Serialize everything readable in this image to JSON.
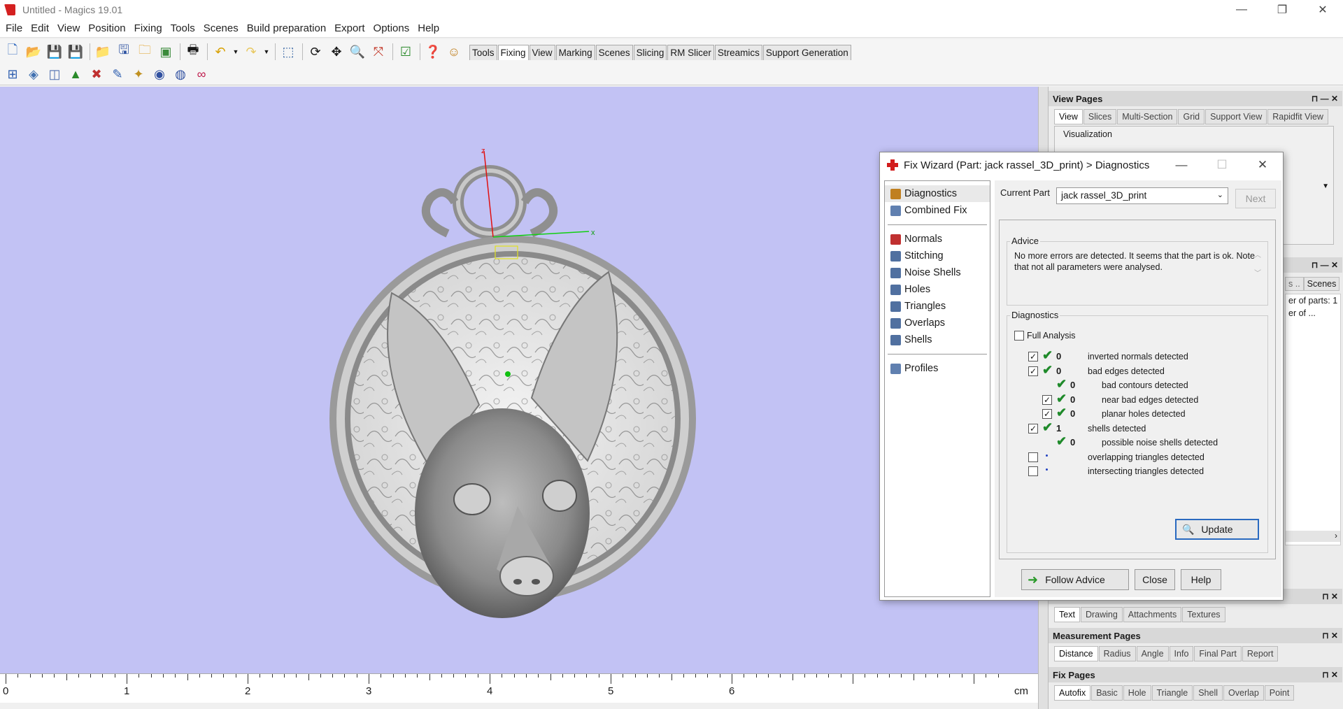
{
  "window": {
    "title": "Untitled - Magics 19.01",
    "min": "—",
    "max": "❐",
    "close": "✕"
  },
  "menu": [
    "File",
    "Edit",
    "View",
    "Position",
    "Fixing",
    "Tools",
    "Scenes",
    "Build preparation",
    "Export",
    "Options",
    "Help"
  ],
  "toolbar_tabs": [
    "Tools",
    "Fixing",
    "View",
    "Marking",
    "Scenes",
    "Slicing",
    "RM Slicer",
    "Streamics",
    "Support Generation"
  ],
  "active_toolbar_tab": "Fixing",
  "axes": {
    "z": "z",
    "x": "x"
  },
  "ruler": {
    "ticks": [
      "0",
      "1",
      "2",
      "3",
      "4",
      "5",
      "6"
    ],
    "unit": "cm"
  },
  "dock": {
    "view_pages": {
      "title": "View Pages",
      "tabs": [
        "View",
        "Slices",
        "Multi-Section",
        "Grid",
        "Support View",
        "Rapidfit View"
      ],
      "group": "Visualization"
    },
    "part_panel": {
      "tabs": [
        "s ..",
        "Scenes"
      ],
      "line1": "er of parts: 1",
      "line2": "er of ..."
    },
    "middle_tabs": [
      "Text",
      "Drawing",
      "Attachments",
      "Textures"
    ],
    "measurement_pages": {
      "title": "Measurement Pages",
      "tabs": [
        "Distance",
        "Radius",
        "Angle",
        "Info",
        "Final Part",
        "Report"
      ]
    },
    "fix_pages": {
      "title": "Fix Pages",
      "tabs": [
        "Autofix",
        "Basic",
        "Hole",
        "Triangle",
        "Shell",
        "Overlap",
        "Point"
      ]
    }
  },
  "dialog": {
    "title": "Fix Wizard (Part: jack rassel_3D_print) > Diagnostics",
    "nav_top": [
      "Diagnostics",
      "Combined Fix"
    ],
    "nav_mid": [
      "Normals",
      "Stitching",
      "Noise Shells",
      "Holes",
      "Triangles",
      "Overlaps",
      "Shells"
    ],
    "nav_bottom": [
      "Profiles"
    ],
    "current_part_label": "Current Part",
    "current_part": "jack rassel_3D_print",
    "next": "Next",
    "advice_title": "Advice",
    "advice_text": "No more errors are detected. It seems that the part is ok. Note that not all parameters were analysed.",
    "diagnostics_title": "Diagnostics",
    "full_analysis": "Full Analysis",
    "rows": [
      {
        "checked": true,
        "ok": true,
        "count": "0",
        "text": "inverted normals detected",
        "indent": 0
      },
      {
        "checked": true,
        "ok": true,
        "count": "0",
        "text": "bad edges detected",
        "indent": 0
      },
      {
        "checked": null,
        "ok": true,
        "count": "0",
        "text": "bad contours detected",
        "indent": 1
      },
      {
        "checked": true,
        "ok": true,
        "count": "0",
        "text": "near bad edges detected",
        "indent": 1
      },
      {
        "checked": true,
        "ok": true,
        "count": "0",
        "text": "planar holes detected",
        "indent": 1
      },
      {
        "checked": true,
        "ok": true,
        "count": "1",
        "text": "shells detected",
        "indent": 0
      },
      {
        "checked": null,
        "ok": true,
        "count": "0",
        "text": "possible noise shells detected",
        "indent": 1
      },
      {
        "checked": false,
        "ok": false,
        "count": "",
        "text": "overlapping triangles detected",
        "indent": 0
      },
      {
        "checked": false,
        "ok": false,
        "count": "",
        "text": "intersecting triangles detected",
        "indent": 0
      }
    ],
    "update": "Update",
    "follow_advice": "Follow Advice",
    "close": "Close",
    "help": "Help"
  }
}
